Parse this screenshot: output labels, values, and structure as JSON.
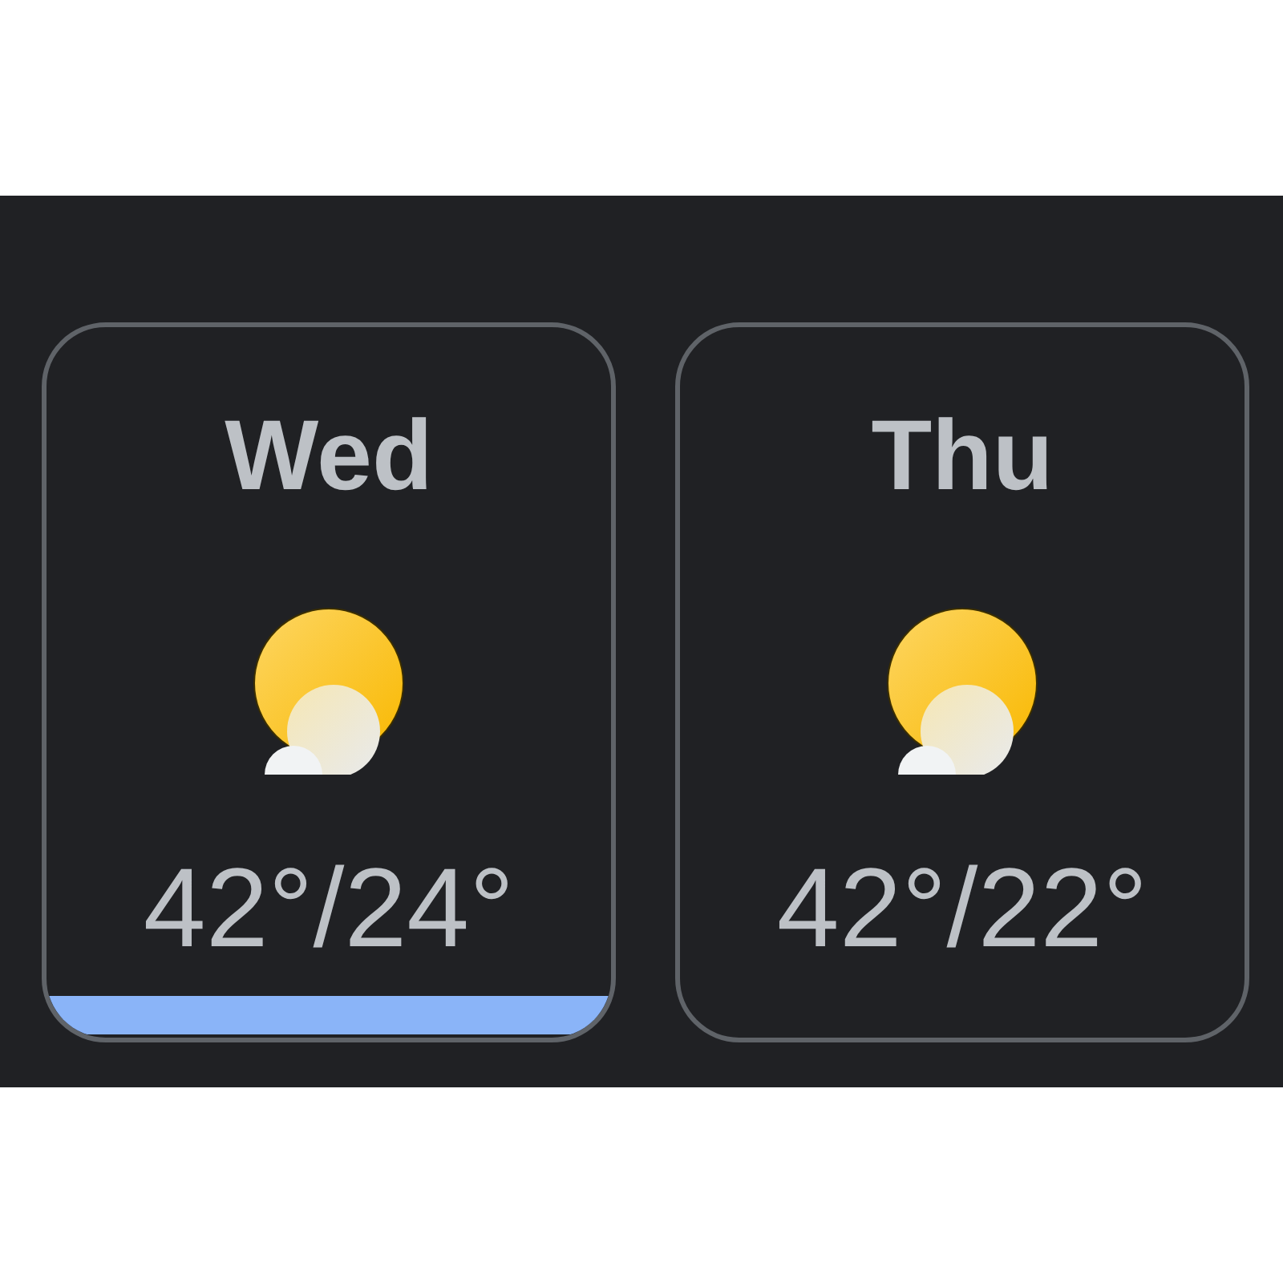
{
  "days": [
    {
      "label": "Wed",
      "temps": "42°/24°",
      "selected": true
    },
    {
      "label": "Thu",
      "temps": "42°/22°",
      "selected": false
    }
  ]
}
